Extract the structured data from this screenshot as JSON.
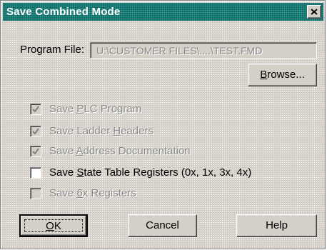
{
  "dialog": {
    "title": "Save Combined Mode"
  },
  "program_file": {
    "label": "Program File:",
    "value": "U:\\CUSTOMER FILES\\....\\TEST.FMD"
  },
  "buttons": {
    "browse": {
      "pre": "",
      "u": "B",
      "post": "rowse..."
    },
    "ok": {
      "pre": "",
      "u": "O",
      "post": "K"
    },
    "cancel": {
      "label": "Cancel"
    },
    "help": {
      "label": "Help"
    }
  },
  "options": [
    {
      "pre": "Save ",
      "u": "P",
      "post": "LC Program",
      "checked": true,
      "enabled": false
    },
    {
      "pre": "Save Ladder ",
      "u": "H",
      "post": "eaders",
      "checked": true,
      "enabled": false
    },
    {
      "pre": "Save ",
      "u": "A",
      "post": "ddress Documentation",
      "checked": true,
      "enabled": false
    },
    {
      "pre": "Save ",
      "u": "S",
      "post": "tate Table Registers (0x, 1x, 3x, 4x)",
      "checked": false,
      "enabled": true
    },
    {
      "pre": "Save ",
      "u": "6",
      "post": "x Registers",
      "checked": false,
      "enabled": false
    }
  ],
  "icons": {
    "close": "close-icon",
    "check": "checkmark-icon"
  }
}
